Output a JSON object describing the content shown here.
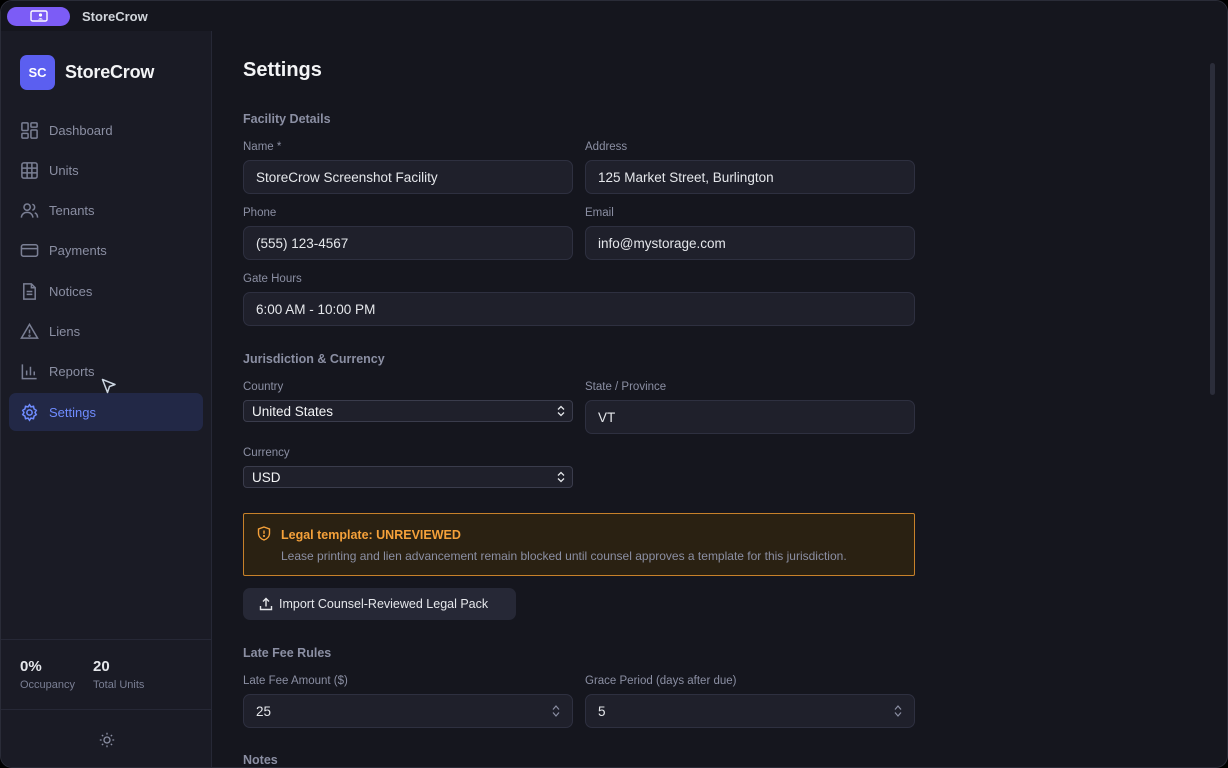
{
  "app": {
    "title": "StoreCrow"
  },
  "brand": {
    "logo": "SC",
    "name": "StoreCrow"
  },
  "nav": [
    {
      "label": "Dashboard",
      "icon": "dashboard-icon"
    },
    {
      "label": "Units",
      "icon": "grid-icon"
    },
    {
      "label": "Tenants",
      "icon": "users-icon"
    },
    {
      "label": "Payments",
      "icon": "credit-card-icon"
    },
    {
      "label": "Notices",
      "icon": "document-icon"
    },
    {
      "label": "Liens",
      "icon": "warning-icon"
    },
    {
      "label": "Reports",
      "icon": "bar-chart-icon"
    },
    {
      "label": "Settings",
      "icon": "gear-icon",
      "active": true
    }
  ],
  "stats": {
    "occupancy": {
      "value": "0%",
      "label": "Occupancy"
    },
    "total_units": {
      "value": "20",
      "label": "Total Units"
    }
  },
  "page": {
    "title": "Settings"
  },
  "facility": {
    "section": "Facility Details",
    "name_label": "Name *",
    "name_value": "StoreCrow Screenshot Facility",
    "address_label": "Address",
    "address_value": "125 Market Street, Burlington",
    "phone_label": "Phone",
    "phone_value": "(555) 123-4567",
    "email_label": "Email",
    "email_value": "info@mystorage.com",
    "gate_label": "Gate Hours",
    "gate_value": "6:00 AM - 10:00 PM"
  },
  "jurisdiction": {
    "section": "Jurisdiction & Currency",
    "country_label": "Country",
    "country_value": "United States",
    "state_label": "State / Province",
    "state_value": "VT",
    "currency_label": "Currency",
    "currency_value": "USD"
  },
  "legal": {
    "title": "Legal template: UNREVIEWED",
    "description": "Lease printing and lien advancement remain blocked until counsel approves a template for this jurisdiction.",
    "import_button": "Import Counsel-Reviewed Legal Pack"
  },
  "late_fee": {
    "section": "Late Fee Rules",
    "amount_label": "Late Fee Amount ($)",
    "amount_value": "25",
    "grace_label": "Grace Period (days after due)",
    "grace_value": "5"
  },
  "notes": {
    "section": "Notes"
  },
  "colors": {
    "accent": "#6f8cff",
    "brand": "#5b5ff0",
    "warning": "#f5a13a"
  }
}
